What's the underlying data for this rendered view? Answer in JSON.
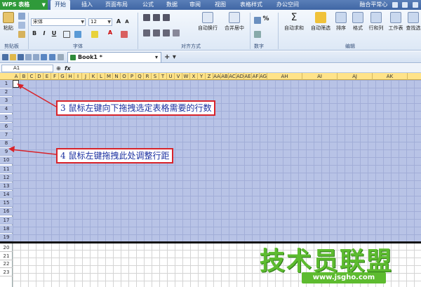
{
  "app": {
    "name": "WPS 表格",
    "menu_tabs": [
      "开始",
      "插入",
      "页面布局",
      "公式",
      "数据",
      "审阅",
      "视图",
      "表格样式",
      "办公空间"
    ],
    "active_tab": "开始",
    "user": "融合平常心"
  },
  "ribbon": {
    "clipboard": {
      "paste": "粘贴",
      "label": "剪贴板"
    },
    "font": {
      "name": "宋体",
      "size": "12",
      "label": "字体"
    },
    "align": {
      "wrap": "自动换行",
      "merge": "合并居中",
      "label": "对齐方式"
    },
    "number": {
      "percent": "%",
      "label": "数字"
    },
    "edit": {
      "sum": "自动求和",
      "filter": "自动筛选",
      "sort": "排序",
      "format": "格式",
      "rowcol": "行和列",
      "sheet": "工作表",
      "find": "查找选",
      "label": "编辑"
    }
  },
  "document": {
    "tab_name": "Book1",
    "modified": "*"
  },
  "formula_bar": {
    "cell_ref": "A1",
    "fx": "fx"
  },
  "grid": {
    "columns": [
      "A",
      "B",
      "C",
      "D",
      "E",
      "F",
      "G",
      "H",
      "I",
      "J",
      "K",
      "L",
      "M",
      "N",
      "O",
      "P",
      "Q",
      "R",
      "S",
      "T",
      "U",
      "V",
      "W",
      "X",
      "Y",
      "Z",
      "AA",
      "AB",
      "AC",
      "AD",
      "AE",
      "AF",
      "AG",
      "AH",
      "AI",
      "AJ",
      "AK"
    ],
    "rows": [
      "1",
      "2",
      "3",
      "4",
      "5",
      "6",
      "7",
      "8",
      "9",
      "10",
      "11",
      "12",
      "13",
      "14",
      "15",
      "16",
      "17",
      "18",
      "19",
      "20",
      "21",
      "22",
      "23"
    ],
    "selected_rows": 19
  },
  "annotations": {
    "note1": "3 鼠标左键向下拖拽选定表格需要的行数",
    "note2": "4 鼠标左键拖拽此处调整行距"
  },
  "watermark": {
    "text": "技术员联盟",
    "url": "www.jsgho.com"
  },
  "colors": {
    "selection": "#b8c3e6",
    "header": "#ffe389",
    "note_border": "#d8232a",
    "note_text": "#1a2fa0",
    "watermark": "#5dbb2f"
  }
}
